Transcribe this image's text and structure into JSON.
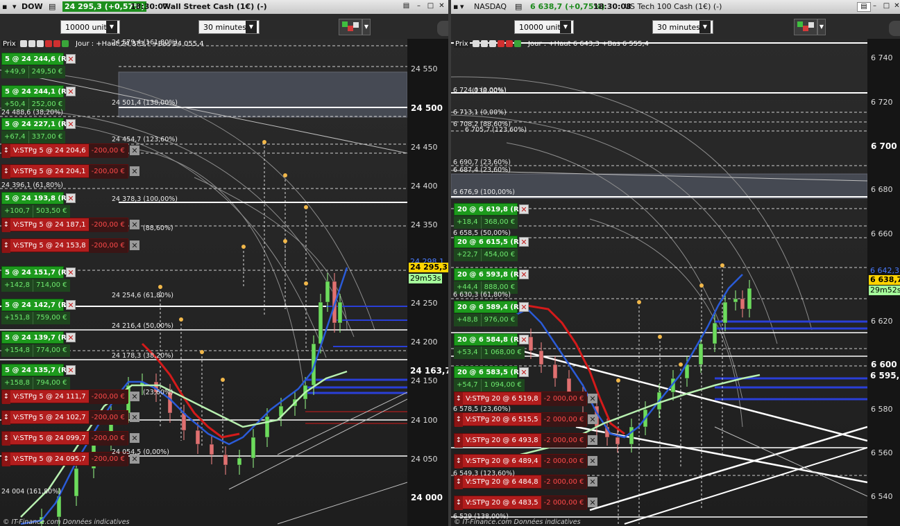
{
  "left": {
    "symbol": "DOW",
    "price_change": "24 295,3 (+0,57%)",
    "time": "18:30:07",
    "instrument": "Wall Street Cash (1€) (-)",
    "quantity": "10000 unités",
    "timeframe": "30 minutes",
    "prix_label": "Prix",
    "day_info": "Jour : +Haut 24 3?3,? +Bas 24 055,4",
    "footer": "© IT-Finance.com Données indicatives",
    "axis": [
      {
        "label": "24 550",
        "major": false
      },
      {
        "label": "24 500",
        "major": true
      },
      {
        "label": "24 450",
        "major": false
      },
      {
        "label": "24 400",
        "major": false
      },
      {
        "label": "24 350",
        "major": false
      },
      {
        "label": "24 250",
        "major": false
      },
      {
        "label": "24 200",
        "major": false
      },
      {
        "label": "24 150",
        "major": false
      },
      {
        "label": "24 100",
        "major": false
      },
      {
        "label": "24 050",
        "major": false
      },
      {
        "label": "24 000",
        "major": true
      }
    ],
    "tags": {
      "high": "24 298,1",
      "last": "24 295,3",
      "countdown": "29m53s",
      "level": "24 163,7"
    },
    "fib_labels": [
      "24 579,4 (161,80%)",
      "24 501,4 (138,00%)",
      "24 488,6 (38,20%)",
      "24 454,7 (123,60%)",
      "24 396,1 (61,80%)",
      "24 378,3 (100,00%)",
      "(88,60%)",
      "24 254,6 (61,80%)",
      "24 216,4 (50,00%)",
      "24 178,3 (38,20%)",
      "(23,60%)",
      "24 054,5 (0,00%)",
      "24 004 (161,80%)"
    ],
    "orders": [
      {
        "type": "pos",
        "label": "5 @ 24 244,6 (RL)",
        "pts": "+49,9",
        "eur": "249,50 €"
      },
      {
        "type": "pos",
        "label": "5 @ 24 244,1 (RL)",
        "pts": "+50,4",
        "eur": "252,00 €"
      },
      {
        "type": "pos",
        "label": "5 @ 24 227,1 (RL)",
        "pts": "+67,4",
        "eur": "337,00 €"
      },
      {
        "type": "stop",
        "label": "V:STPg  5 @ 24 204,6",
        "amt": "-200,00 €"
      },
      {
        "type": "stop",
        "label": "V:STPg  5 @ 24 204,1",
        "amt": "-200,00 €"
      },
      {
        "type": "pos",
        "label": "5 @ 24 193,8 (RL)",
        "pts": "+100,7",
        "eur": "503,50 €"
      },
      {
        "type": "stop",
        "label": "V:STPg  5 @ 24 187,1",
        "amt": "-200,00 €"
      },
      {
        "type": "stop",
        "label": "V:STPg  5 @ 24 153,8",
        "amt": "-200,00 €"
      },
      {
        "type": "pos",
        "label": "5 @ 24 151,7 (RL)",
        "pts": "+142,8",
        "eur": "714,00 €"
      },
      {
        "type": "pos",
        "label": "5 @ 24 142,7 (RL)",
        "pts": "+151,8",
        "eur": "759,00 €"
      },
      {
        "type": "pos",
        "label": "5 @ 24 139,7 (RL)",
        "pts": "+154,8",
        "eur": "774,00 €"
      },
      {
        "type": "pos",
        "label": "5 @ 24 135,7 (RL)",
        "pts": "+158,8",
        "eur": "794,00 €"
      },
      {
        "type": "stop",
        "label": "V:STPg  5 @ 24 111,7",
        "amt": "-200,00 €"
      },
      {
        "type": "stop",
        "label": "V:STPg  5 @ 24 102,7",
        "amt": "-200,00 €"
      },
      {
        "type": "stop",
        "label": "V:STPg  5 @ 24 099,7",
        "amt": "-200,00 €"
      },
      {
        "type": "stop",
        "label": "V:STPg  5 @ 24 095,7",
        "amt": "-200,00 €"
      }
    ]
  },
  "right": {
    "symbol": "NASDAQ",
    "price_change": "6 638,7 (+0,75%)",
    "time": "18:30:08",
    "instrument": "US Tech 100 Cash (1€) (-)",
    "quantity": "10000 unités",
    "timeframe": "30 minutes",
    "prix_label": "Prix",
    "day_info": "Jour : +Haut 6 643,3 +Bas 6 555,4",
    "footer": "© IT-Finance.com Données indicatives",
    "axis": [
      {
        "label": "6 740",
        "major": false
      },
      {
        "label": "6 720",
        "major": false
      },
      {
        "label": "6 700",
        "major": true
      },
      {
        "label": "6 680",
        "major": false
      },
      {
        "label": "6 660",
        "major": false
      },
      {
        "label": "6 620",
        "major": false
      },
      {
        "label": "6 600",
        "major": true
      },
      {
        "label": "6 580",
        "major": false
      },
      {
        "label": "6 560",
        "major": false
      },
      {
        "label": "6 540",
        "major": false
      }
    ],
    "tags": {
      "high": "6 642,3",
      "last": "6 638,7",
      "countdown": "29m52s",
      "level": "6 595,1"
    },
    "fib_labels": [
      "6 724,0 (0,00%)",
      "(138,00%)",
      "6 713,1 (0,00%)",
      "6 708,2 (88,60%)",
      "6 705,7 (123,60%)",
      "6 690,7 (23,60%)",
      "6 687,4 (23,60%)",
      "6 676,9 (100,00%)",
      "6 658,5 (50,00%)",
      "6 630,3 (61,80%)",
      "6 578,5 (23,60%)",
      "6 549,3 (123,60%)",
      "6 529 (138,00%)"
    ],
    "orders": [
      {
        "type": "pos",
        "label": "20 @ 6 619,8 (RL)",
        "pts": "+18,4",
        "eur": "368,00 €"
      },
      {
        "type": "pos",
        "label": "20 @ 6 615,5 (RL)",
        "pts": "+22,7",
        "eur": "454,00 €"
      },
      {
        "type": "pos",
        "label": "20 @ 6 593,8 (RL)",
        "pts": "+44,4",
        "eur": "888,00 €"
      },
      {
        "type": "pos",
        "label": "20 @ 6 589,4 (RL)",
        "pts": "+48,8",
        "eur": "976,00 €"
      },
      {
        "type": "pos",
        "label": "20 @ 6 584,8 (RL)",
        "pts": "+53,4",
        "eur": "1 068,00 €"
      },
      {
        "type": "pos",
        "label": "20 @ 6 583,5 (RL)",
        "pts": "+54,7",
        "eur": "1 094,00 €"
      },
      {
        "type": "stop",
        "label": "V:STPg  20 @ 6 519,8",
        "amt": "-2 000,00 €"
      },
      {
        "type": "stop",
        "label": "V:STPg  20 @ 6 515,5",
        "amt": "-2 000,00 €"
      },
      {
        "type": "stop",
        "label": "V:STPg  20 @ 6 493,8",
        "amt": "-2 000,00 €"
      },
      {
        "type": "stop",
        "label": "V:STPg  20 @ 6 489,4",
        "amt": "-2 000,00 €"
      },
      {
        "type": "stop",
        "label": "V:STPg  20 @ 6 484,8",
        "amt": "-2 000,00 €"
      },
      {
        "type": "stop",
        "label": "V:STPg  20 @ 6 483,5",
        "amt": "-2 000,00 €"
      }
    ]
  },
  "colors": {
    "pos_green": "#1d9a1d",
    "stop_red": "#b21d1d",
    "blue_line": "#2a5bd8",
    "red_line": "#d41a1a",
    "light_green_line": "#b8f0b0",
    "accent_orange": "#f2b84a"
  },
  "icons": [
    "settings-icon",
    "close-icon",
    "minimize-icon",
    "maximize-icon",
    "dropdown-caret-icon",
    "chart-tools-icon",
    "wrench-icon"
  ]
}
